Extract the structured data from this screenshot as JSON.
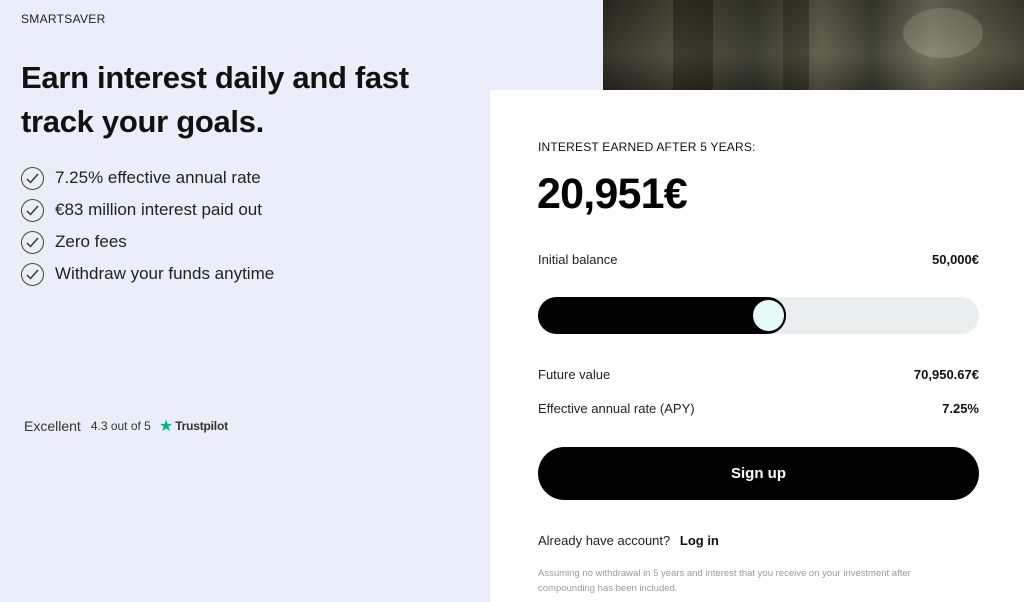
{
  "brand": "SMARTSAVER",
  "headline": "Earn interest daily and fast track your goals.",
  "features": [
    {
      "icon": "check-icon",
      "text": "7.25% effective annual rate"
    },
    {
      "icon": "check-icon",
      "text": "€83 million interest paid out"
    },
    {
      "icon": "check-icon",
      "text": "Zero fees"
    },
    {
      "icon": "check-icon",
      "text": "Withdraw your funds anytime"
    }
  ],
  "trustpilot": {
    "rating_word": "Excellent",
    "score": "4.3 out of 5",
    "brand": "Trustpilot",
    "star_color": "#00b67a"
  },
  "calculator": {
    "heading": "INTEREST EARNED AFTER 5 YEARS:",
    "interest_earned": "20,951€",
    "initial_balance_label": "Initial balance",
    "initial_balance_value": "50,000€",
    "slider_level": 0.49,
    "future_value_label": "Future value",
    "future_value": "70,950.67€",
    "apy_label": "Effective annual rate (APY)",
    "apy_value": "7.25%",
    "signup_label": "Sign up",
    "account_prompt": "Already have account?",
    "login_label": "Log in",
    "disclaimer": "Assuming no withdrawal in 5 years and interest that you receive on your investment after compounding has been included."
  },
  "colors": {
    "page_background": "#e9eef8",
    "card_background": "#ffffff",
    "primary_button": "#000000",
    "slider_track": "#e9eeee",
    "slider_thumb": "#e8fbfb"
  }
}
